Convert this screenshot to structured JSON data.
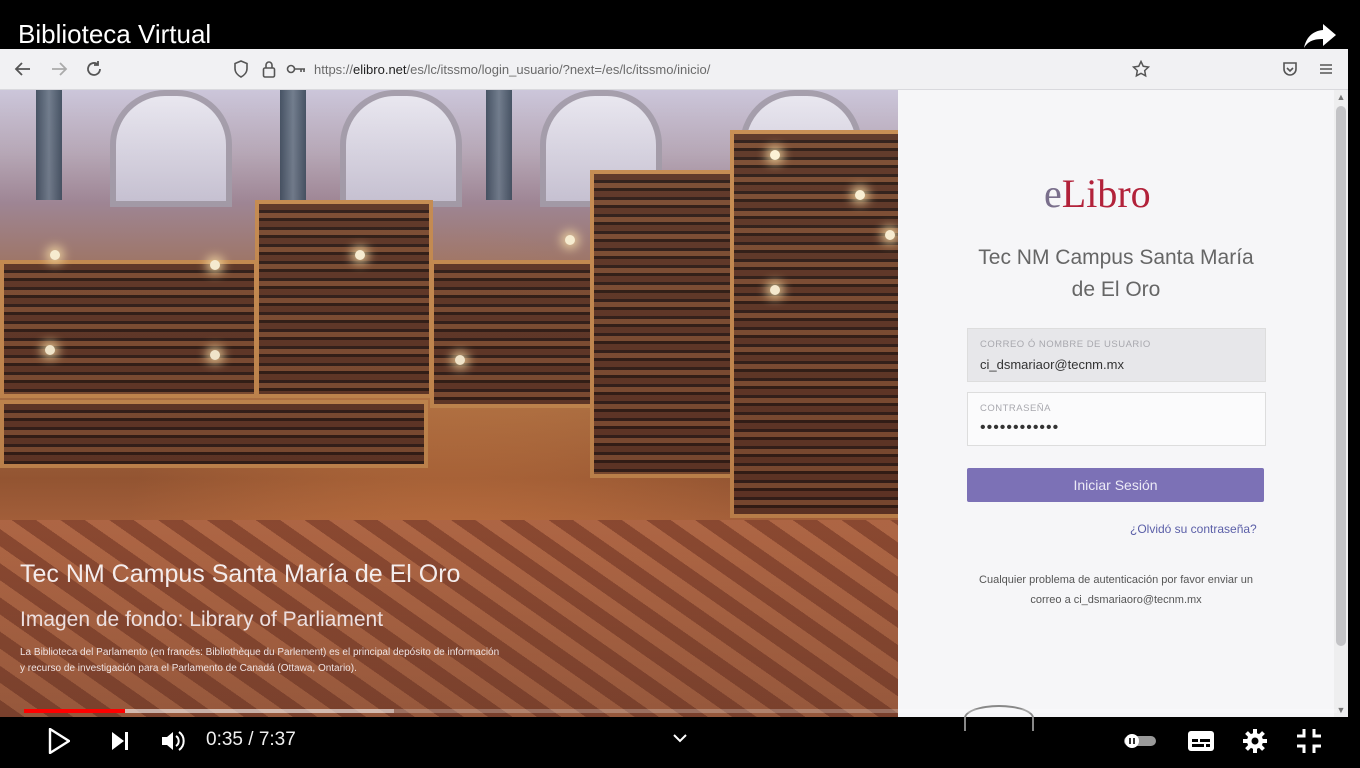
{
  "video": {
    "title": "Biblioteca Virtual",
    "current_time": "0:35",
    "duration": "7:37",
    "time_display": "0:35 / 7:37",
    "progress_fraction": 0.077,
    "buffered_fraction": 0.282,
    "icons": [
      "share-icon",
      "play-icon",
      "next-icon",
      "volume-icon",
      "chevron-down-icon",
      "autoplay-toggle-icon",
      "subtitles-icon",
      "settings-icon",
      "exit-fullscreen-icon"
    ]
  },
  "browser": {
    "url_prefix": "https://",
    "url_domain": "elibro.net",
    "url_path": "/es/lc/itssmo/login_usuario/?next=/es/lc/itssmo/inicio/",
    "icons": [
      "back-icon",
      "forward-icon",
      "reload-icon",
      "shield-icon",
      "lock-icon",
      "key-icon",
      "bookmark-star-icon",
      "pocket-icon",
      "menu-icon"
    ]
  },
  "hero": {
    "title": "Tec NM Campus Santa María de El Oro",
    "subtitle": "Imagen de fondo: Library of Parliament",
    "description": "La Biblioteca del Parlamento (en francés: Bibliothèque du Parlement) es el principal depósito de información y recurso de investigación para el Parlamento de Canadá (Ottawa, Ontario)."
  },
  "login": {
    "logo_e": "e",
    "logo_rest": "Libro",
    "campus_line1": "Tec NM Campus Santa María",
    "campus_line2": "de El Oro",
    "user_label": "CORREO Ó NOMBRE DE USUARIO",
    "user_value": "ci_dsmariaor@tecnm.mx",
    "password_label": "CONTRASEÑA",
    "password_mask": "••••••••••••",
    "submit_label": "Iniciar Sesión",
    "forgot_label": "¿Olvidó su contraseña?",
    "help_line1": "Cualquier problema de autenticación por favor enviar un",
    "help_line2": "correo a ci_dsmariaoro@tecnm.mx"
  },
  "colors": {
    "button": "#7c71b6",
    "logo_red": "#b2223a",
    "progress": "#ff0000"
  }
}
